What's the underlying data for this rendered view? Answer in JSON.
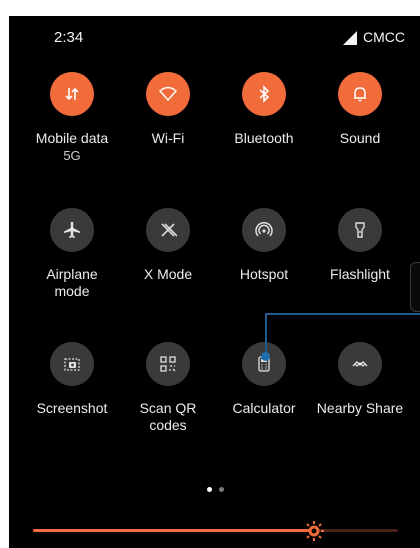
{
  "status_bar": {
    "time": "2:34",
    "carrier": "CMCC"
  },
  "tiles": [
    {
      "label": "Mobile data",
      "sublabel": "5G",
      "state": "on",
      "icon": "mobile-data-icon"
    },
    {
      "label": "Wi-Fi",
      "state": "on",
      "icon": "wifi-icon"
    },
    {
      "label": "Bluetooth",
      "state": "on",
      "icon": "bluetooth-icon"
    },
    {
      "label": "Sound",
      "state": "on",
      "icon": "bell-icon"
    },
    {
      "label": "Airplane\nmode",
      "state": "off",
      "icon": "airplane-icon"
    },
    {
      "label": "X Mode",
      "state": "off",
      "icon": "x-mode-icon"
    },
    {
      "label": "Hotspot",
      "state": "off",
      "icon": "hotspot-icon"
    },
    {
      "label": "Flashlight",
      "state": "off",
      "icon": "flashlight-icon"
    },
    {
      "label": "Screenshot",
      "state": "off",
      "icon": "screenshot-icon"
    },
    {
      "label": "Scan QR\ncodes",
      "state": "off",
      "icon": "qr-code-icon"
    },
    {
      "label": "Calculator",
      "state": "off",
      "icon": "calculator-icon"
    },
    {
      "label": "Nearby Share",
      "state": "off",
      "icon": "nearby-share-icon"
    }
  ],
  "pager": {
    "pages": 2,
    "current": 1
  },
  "brightness": {
    "level": 0.77,
    "icon": "brightness-icon"
  },
  "colors": {
    "accent": "#f26b3a",
    "tile_off": "#3a3a3a",
    "background": "#000000",
    "annotation": "#1e5b8c"
  }
}
